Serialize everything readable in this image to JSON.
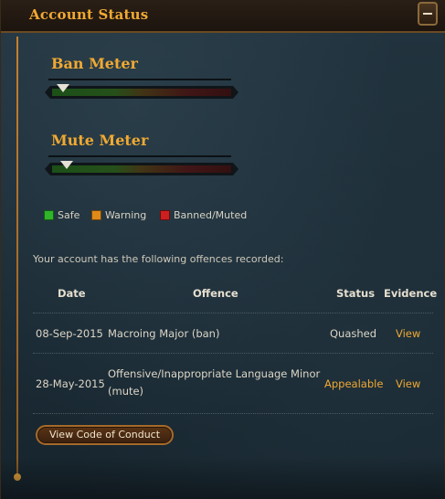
{
  "header": {
    "title": "Account Status"
  },
  "ban_meter": {
    "title": "Ban Meter",
    "level": 0.06
  },
  "mute_meter": {
    "title": "Mute Meter",
    "level": 0.08
  },
  "legend": [
    {
      "label": "Safe",
      "color": "#2fb52a"
    },
    {
      "label": "Warning",
      "color": "#e08a1a"
    },
    {
      "label": "Banned/Muted",
      "color": "#cc1f1f"
    }
  ],
  "offences": {
    "intro": "Your account has the following offences recorded:",
    "headers": {
      "date": "Date",
      "offence": "Offence",
      "status": "Status",
      "evidence": "Evidence"
    },
    "rows": [
      {
        "date": "08-Sep-2015",
        "offence": "Macroing Major (ban)",
        "status": "Quashed",
        "evidence": "View"
      },
      {
        "date": "28-May-2015",
        "offence": "Offensive/Inappropriate Language Minor (mute)",
        "status": "Appealable",
        "evidence": "View"
      }
    ]
  },
  "buttons": {
    "code_of_conduct": "View Code of Conduct"
  },
  "colors": {
    "accent": "#f0a932",
    "text": "#ddd6c7"
  }
}
